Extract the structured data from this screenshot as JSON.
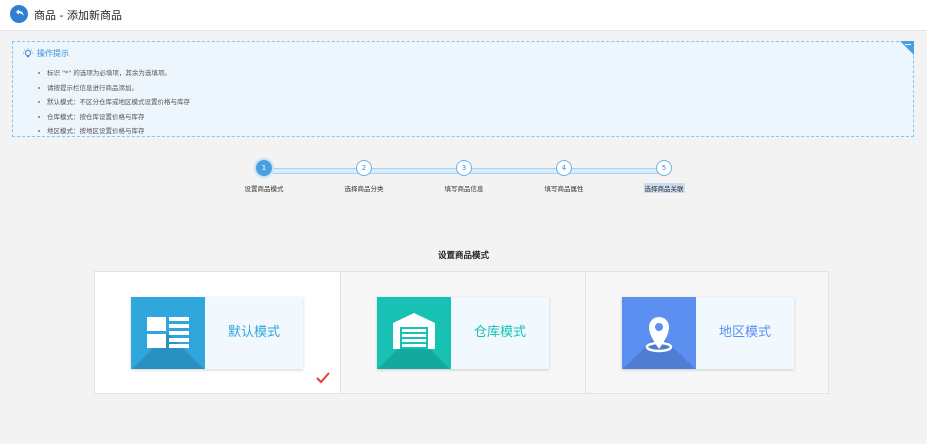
{
  "header": {
    "title": "商品 - 添加新商品"
  },
  "tips": {
    "title": "操作提示",
    "items": [
      "标识 \"*\" 的选项为必填项，其余为选填项。",
      "请按提示栏信息进行商品添加。",
      "默认模式：不区分仓库或地区模式设置价格与库存",
      "仓库模式：按仓库设置价格与库存",
      "地区模式：按地区设置价格与库存"
    ]
  },
  "steps": [
    {
      "num": "1",
      "label": "设置商品模式",
      "active": true
    },
    {
      "num": "2",
      "label": "选择商品分类"
    },
    {
      "num": "3",
      "label": "填写商品信息"
    },
    {
      "num": "4",
      "label": "填写商品属性"
    },
    {
      "num": "5",
      "label": "选择商品关联",
      "highlighted": true
    }
  ],
  "section": {
    "title": "设置商品模式"
  },
  "modes": [
    {
      "label": "默认模式",
      "icon": "list-layout-icon",
      "color": "#2fa6dc",
      "selected": true
    },
    {
      "label": "仓库模式",
      "icon": "warehouse-icon",
      "color": "#17c1b4"
    },
    {
      "label": "地区模式",
      "icon": "map-pin-icon",
      "color": "#5b8ff0"
    }
  ],
  "colors": {
    "accent": "#4a9fe0",
    "check": "#e83a3a"
  }
}
